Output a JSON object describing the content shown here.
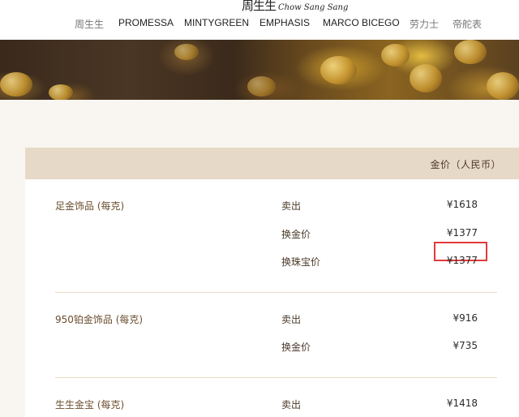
{
  "brand": {
    "logo_cn": "周生生",
    "logo_en": "Chow Sang Sang"
  },
  "nav": [
    {
      "label": "周生生",
      "muted": true
    },
    {
      "label": "PROMESSA",
      "muted": false
    },
    {
      "label": "MINTYGREEN",
      "muted": false
    },
    {
      "label": "EMPHASIS",
      "muted": false
    },
    {
      "label": "MARCO BICEGO",
      "muted": false
    },
    {
      "label": "劳力士",
      "muted": true
    },
    {
      "label": "帝舵表",
      "muted": true
    }
  ],
  "table": {
    "header": "金价（人民币）",
    "groups": [
      {
        "type": "足金饰品 (每克)",
        "rows": [
          {
            "action": "卖出",
            "price": "¥1618"
          },
          {
            "action": "换金价",
            "price": "¥1377"
          },
          {
            "action": "换珠宝价",
            "price": "¥1377"
          }
        ]
      },
      {
        "type": "950铂金饰品 (每克)",
        "rows": [
          {
            "action": "卖出",
            "price": "¥916"
          },
          {
            "action": "换金价",
            "price": "¥735"
          }
        ]
      },
      {
        "type": "生生金宝 (每克)",
        "rows": [
          {
            "action": "卖出",
            "price": "¥1418"
          }
        ]
      }
    ]
  },
  "colors": {
    "highlight": "#e23a3a",
    "header_bg": "#e7d9c7",
    "page_bg": "#f9f6f1"
  }
}
